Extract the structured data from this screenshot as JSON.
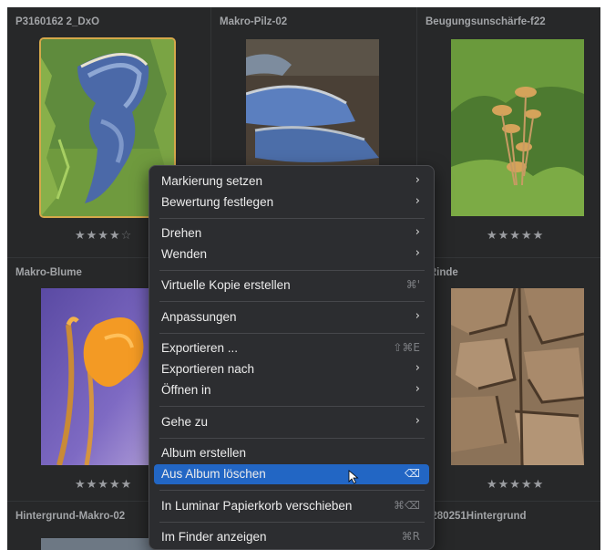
{
  "thumbnails": [
    {
      "title": "P3160162 2_DxO",
      "stars": 4,
      "selected": true
    },
    {
      "title": "Makro-Pilz-02",
      "stars": 0,
      "selected": false
    },
    {
      "title": "Beugungsunschärfe-f22",
      "stars": 5,
      "selected": false
    },
    {
      "title": "Makro-Blume",
      "stars": 5,
      "selected": false
    },
    {
      "title": "",
      "stars": 0,
      "selected": false
    },
    {
      "title": "-Rinde",
      "stars": 5,
      "selected": false
    },
    {
      "title": "Hintergrund-Makro-02",
      "stars": 0,
      "selected": false
    },
    {
      "title": "",
      "stars": 0,
      "selected": false
    },
    {
      "title": "3280251Hintergrund",
      "stars": 0,
      "selected": false
    }
  ],
  "context_menu": {
    "items": [
      {
        "label": "Markierung setzen",
        "submenu": true,
        "shortcut": ""
      },
      {
        "label": "Bewertung festlegen",
        "submenu": true,
        "shortcut": ""
      },
      {
        "label": "Drehen",
        "submenu": true,
        "shortcut": ""
      },
      {
        "label": "Wenden",
        "submenu": true,
        "shortcut": ""
      },
      {
        "label": "Virtuelle Kopie erstellen",
        "submenu": false,
        "shortcut": "⌘'"
      },
      {
        "label": "Anpassungen",
        "submenu": true,
        "shortcut": ""
      },
      {
        "label": "Exportieren ...",
        "submenu": false,
        "shortcut": "⇧⌘E"
      },
      {
        "label": "Exportieren nach",
        "submenu": true,
        "shortcut": ""
      },
      {
        "label": "Öffnen in",
        "submenu": true,
        "shortcut": ""
      },
      {
        "label": "Gehe zu",
        "submenu": true,
        "shortcut": ""
      },
      {
        "label": "Album erstellen",
        "submenu": false,
        "shortcut": ""
      },
      {
        "label": "Aus Album löschen",
        "submenu": false,
        "shortcut": "⌫",
        "highlighted": true
      },
      {
        "label": "In Luminar Papierkorb verschieben",
        "submenu": false,
        "shortcut": "⌘⌫"
      },
      {
        "label": "Im Finder anzeigen",
        "submenu": false,
        "shortcut": "⌘R"
      }
    ],
    "chevron": "›"
  },
  "colors": {
    "background": "#272829",
    "menu_background": "#2c2d30",
    "highlight": "#2266c4",
    "selection_border": "#d5a84a"
  }
}
